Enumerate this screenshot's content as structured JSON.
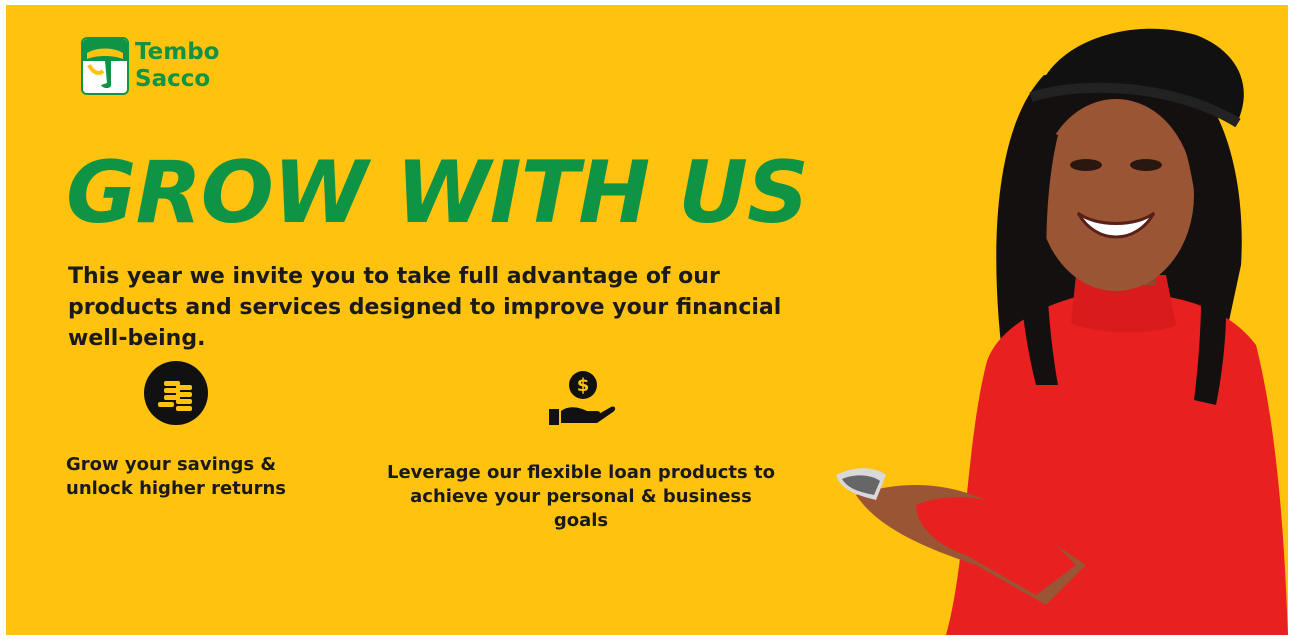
{
  "brand": {
    "name_line1": "Tembo",
    "name_line2": "Sacco",
    "logo_icon": "tembo-sacco-logo-icon"
  },
  "headline": "GROW WITH US",
  "intro_text": "This year we invite you to take full advantage of our products and services designed to improve your financial well-being.",
  "features": [
    {
      "icon": "coins-icon",
      "text": "Grow your savings & unlock higher returns"
    },
    {
      "icon": "hand-dollar-icon",
      "text": "Leverage our flexible loan products to achieve your personal & business goals"
    }
  ],
  "colors": {
    "background": "#FFC20E",
    "brand_green": "#0E9444",
    "text_dark": "#1a1a1a",
    "sweater_red": "#E82020",
    "hat_black": "#111111"
  }
}
